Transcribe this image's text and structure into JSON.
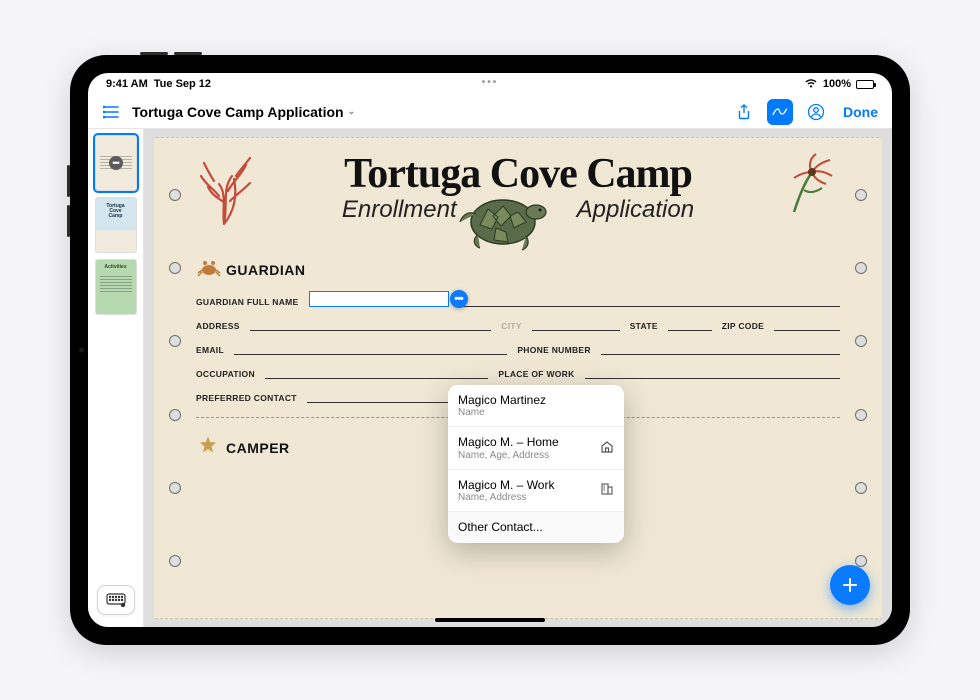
{
  "status": {
    "time": "9:41 AM",
    "date": "Tue Sep 12",
    "battery": "100%"
  },
  "toolbar": {
    "title": "Tortuga Cove Camp Application",
    "done": "Done"
  },
  "thumbnails": {
    "p2_line1": "Tortuga",
    "p2_line2": "Cove",
    "p2_line3": "Camp",
    "p3_title": "Activities"
  },
  "doc": {
    "title_main": "Tortuga Cove Camp",
    "title_left": "Enrollment",
    "title_right": "Application",
    "section_guardian": "GUARDIAN",
    "section_camper": "CAMPER",
    "labels": {
      "full_name": "GUARDIAN FULL NAME",
      "address": "ADDRESS",
      "city": "CITY",
      "state": "STATE",
      "zip": "ZIP CODE",
      "email": "EMAIL",
      "phone": "PHONE NUMBER",
      "occupation": "OCCUPATION",
      "workplace": "PLACE OF WORK",
      "preferred": "PREFERRED CONTACT"
    }
  },
  "autofill": {
    "items": [
      {
        "title": "Magico Martinez",
        "sub": "Name"
      },
      {
        "title": "Magico M. – Home",
        "sub": "Name, Age, Address",
        "icon": "home"
      },
      {
        "title": "Magico M. – Work",
        "sub": "Name, Address",
        "icon": "building"
      }
    ],
    "other": "Other Contact..."
  }
}
